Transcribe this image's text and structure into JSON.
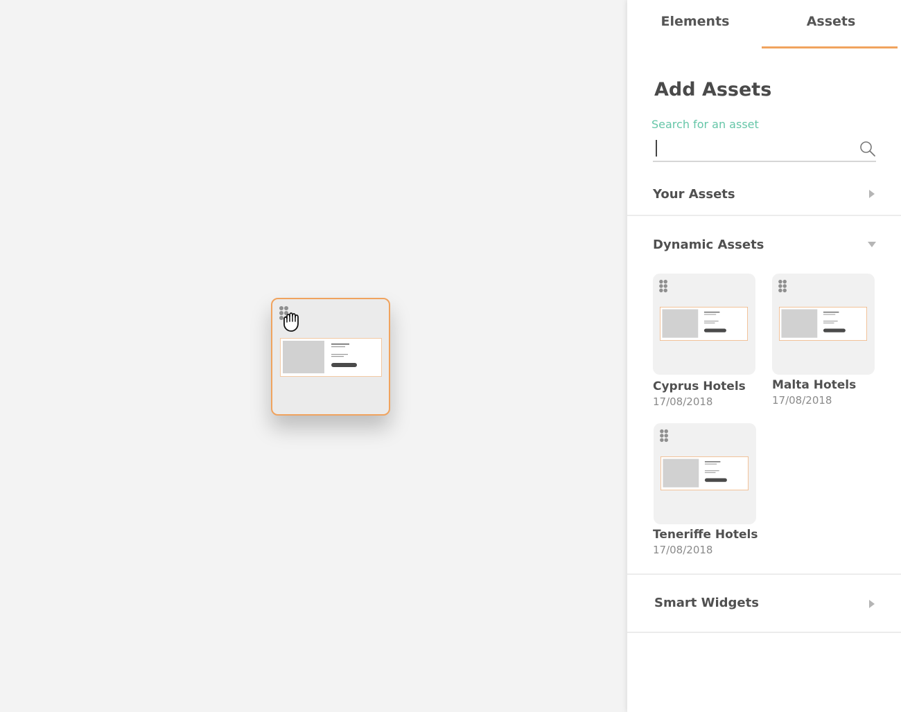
{
  "tabs": [
    {
      "label": "Elements",
      "active": false
    },
    {
      "label": "Assets",
      "active": true
    }
  ],
  "panel": {
    "title": "Add Assets",
    "search": {
      "label": "Search for an asset",
      "value": "",
      "placeholder": ""
    }
  },
  "sections": {
    "your_assets": {
      "title": "Your Assets",
      "expanded": false
    },
    "dynamic_assets": {
      "title": "Dynamic Assets",
      "expanded": true,
      "items": [
        {
          "name": "Cyprus Hotels",
          "date": "17/08/2018"
        },
        {
          "name": "Malta Hotels",
          "date": "17/08/2018"
        },
        {
          "name": "Teneriffe Hotels",
          "date": "17/08/2018"
        }
      ]
    },
    "smart_widgets": {
      "title": "Smart Widgets",
      "expanded": false
    }
  },
  "colors": {
    "accent_orange": "#f0a35e",
    "label_green": "#66c6a8",
    "canvas_bg": "#f3f3f3",
    "panel_bg": "#ffffff"
  },
  "icons": {
    "search": "search-icon",
    "collapsed": "triangle-right-icon",
    "expanded": "triangle-down-icon",
    "drag": "drag-grip-icon",
    "cursor": "grab-hand-icon"
  }
}
